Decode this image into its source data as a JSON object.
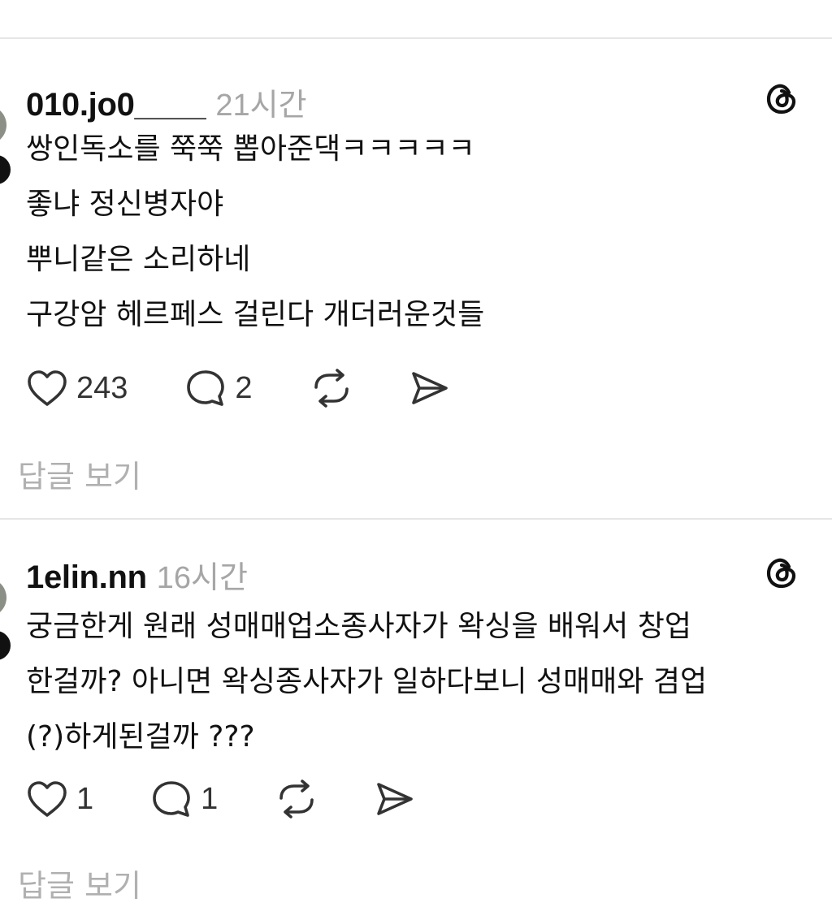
{
  "posts": [
    {
      "username": "010.jo0____",
      "time": "21시간",
      "lines": [
        "쌍인독소를 쭉쭉 뽑아준댁ㅋㅋㅋㅋㅋ",
        "좋냐 정신병자야",
        "뿌니같은 소리하네",
        "구강암 헤르페스 걸린다 개더러운것들"
      ],
      "likes": "243",
      "comments": "2",
      "reply_label": "답글 보기"
    },
    {
      "username": "1elin.nn",
      "time": "16시간",
      "lines": [
        "궁금한게 원래 성매매업소종사자가 왁싱을 배워서 창업",
        "한걸까? 아니면 왁싱종사자가 일하다보니 성매매와 겸업",
        "(?)하게된걸까 ???"
      ],
      "likes": "1",
      "comments": "1",
      "reply_label": "답글 보기"
    }
  ],
  "icons": {
    "threads": "threads-logo-icon",
    "like": "heart-icon",
    "comment": "comment-bubble-icon",
    "repost": "repost-icon",
    "share": "send-icon"
  }
}
